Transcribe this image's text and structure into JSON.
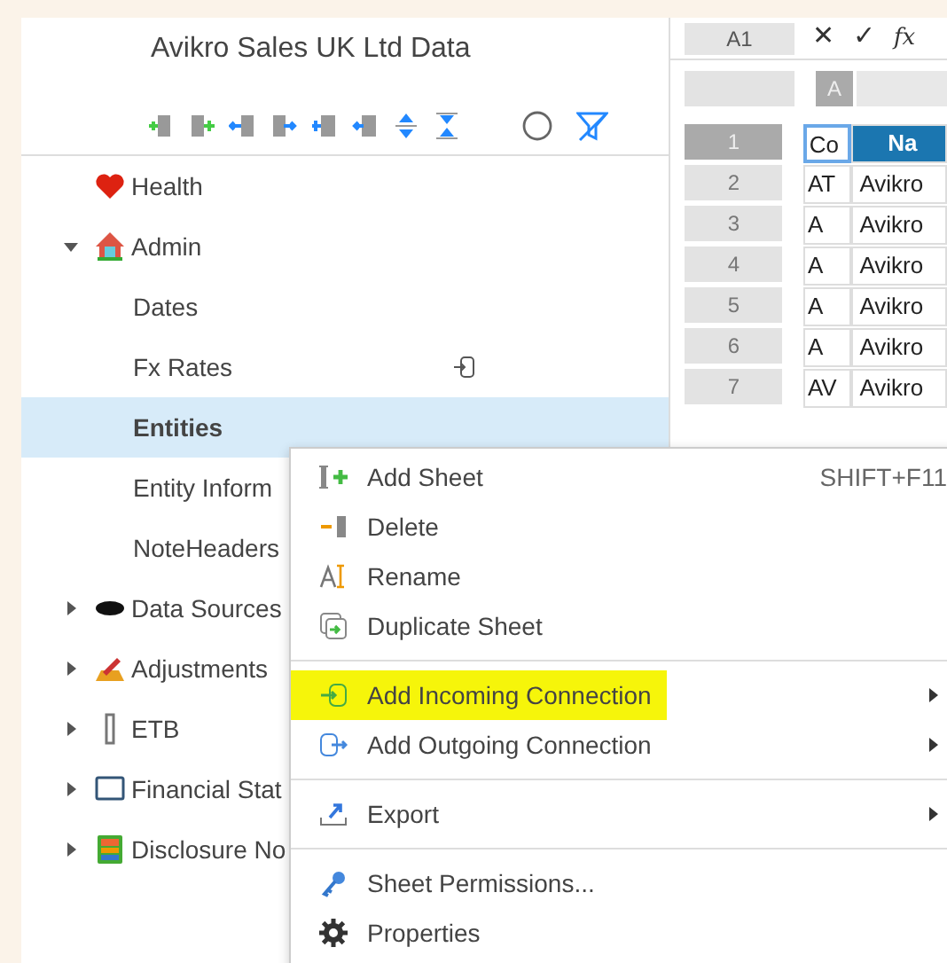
{
  "panel": {
    "title": "Avikro Sales UK Ltd Data"
  },
  "tree": [
    {
      "label": "Health",
      "selected": false
    },
    {
      "label": "Admin",
      "expanded": true,
      "selected": false,
      "children": [
        {
          "label": "Dates",
          "selected": false,
          "connected": false
        },
        {
          "label": "Fx Rates",
          "selected": false,
          "connected": true
        },
        {
          "label": "Entities",
          "selected": true,
          "connected": false
        },
        {
          "label": "Entity Inform",
          "selected": false,
          "connected": false
        },
        {
          "label": "NoteHeaders",
          "selected": false,
          "connected": false
        }
      ]
    },
    {
      "label": "Data Sources",
      "expanded": false,
      "selected": false
    },
    {
      "label": "Adjustments",
      "expanded": false,
      "selected": false
    },
    {
      "label": "ETB",
      "expanded": false,
      "selected": false
    },
    {
      "label": "Financial Stat",
      "expanded": false,
      "selected": false
    },
    {
      "label": "Disclosure No",
      "expanded": false,
      "selected": false
    }
  ],
  "sheet": {
    "name_box": "A1",
    "formula_glyphs": [
      "✕",
      "✓",
      "fx"
    ],
    "columns": [
      "A"
    ],
    "rows": [
      {
        "number": "1",
        "kind": "header",
        "selected": true,
        "cells": [
          "Co",
          "Na"
        ]
      },
      {
        "number": "2",
        "kind": "data",
        "selected": false,
        "cells": [
          "AT",
          "Avikro"
        ]
      },
      {
        "number": "3",
        "kind": "data",
        "selected": false,
        "cells": [
          "A",
          "Avikro"
        ]
      },
      {
        "number": "4",
        "kind": "data",
        "selected": false,
        "cells": [
          "A",
          "Avikro"
        ]
      },
      {
        "number": "5",
        "kind": "data",
        "selected": false,
        "cells": [
          "A",
          "Avikro"
        ]
      },
      {
        "number": "6",
        "kind": "data",
        "selected": false,
        "cells": [
          "A",
          "Avikro"
        ]
      },
      {
        "number": "7",
        "kind": "data",
        "selected": false,
        "cells": [
          "AV",
          "Avikro"
        ]
      }
    ]
  },
  "context_menu": [
    [
      {
        "label": "Add Sheet",
        "shortcut": "SHIFT+F11",
        "submenu": false,
        "highlighted": false
      },
      {
        "label": "Delete",
        "submenu": false,
        "highlighted": false
      },
      {
        "label": "Rename",
        "submenu": false,
        "highlighted": false
      },
      {
        "label": "Duplicate Sheet",
        "submenu": false,
        "highlighted": false
      }
    ],
    [
      {
        "label": "Add Incoming Connection",
        "submenu": true,
        "highlighted": true
      },
      {
        "label": "Add Outgoing Connection",
        "submenu": true,
        "highlighted": false
      }
    ],
    [
      {
        "label": "Export",
        "submenu": true,
        "highlighted": false
      }
    ],
    [
      {
        "label": "Sheet Permissions...",
        "submenu": false,
        "highlighted": false
      },
      {
        "label": "Properties",
        "submenu": false,
        "highlighted": false
      }
    ]
  ]
}
